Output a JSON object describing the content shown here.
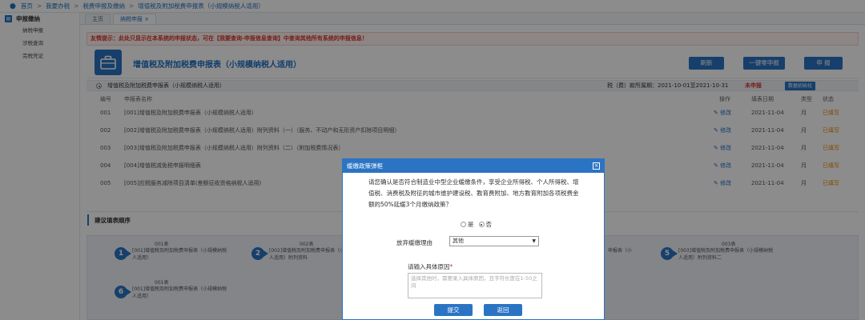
{
  "breadcrumb": [
    "首页",
    "我要办税",
    "税费申报及缴纳",
    "增值税及附加税费申报表（小规模纳税人适用）"
  ],
  "sidebar": {
    "section": "申报缴纳",
    "items": [
      "纳税申报",
      "涉税查询",
      "完税凭证"
    ]
  },
  "tabs": [
    {
      "label": "主页"
    },
    {
      "label": "纳税申报 ×"
    }
  ],
  "warning": "友情提示：此处只显示在本系统的申报状态，可在【我要查询-申报信息查询】中查询其他所有系统的申报信息！",
  "header": {
    "title": "增值税及附加税费申报表（小规模纳税人适用）",
    "refresh_label": "刷新",
    "zero_label": "一键零申报",
    "submit_label": "申  报"
  },
  "infobar": {
    "name": "增值税及附加税费申报表（小规模纳税人适用）",
    "period": "税（费）款所属期：2021-10-01至2021-10-31",
    "status": "未申报",
    "format_label": "数据初始化"
  },
  "table": {
    "headers": [
      "编号",
      "申报表名称",
      "操作",
      "填表日期",
      "类型",
      "状态"
    ],
    "rows": [
      {
        "no": "001",
        "name": "[001]增值税及附加税费申报表（小规模纳税人适用）",
        "op": "修改",
        "date": "2021-11-04",
        "type": "月",
        "status": "已填写"
      },
      {
        "no": "002",
        "name": "[002]增值税及附加税费申报表（小规模纳税人适用）附列资料（一）（服务、不动产和无形资产扣除项目明细）",
        "op": "修改",
        "date": "2021-11-04",
        "type": "月",
        "status": "已填写"
      },
      {
        "no": "003",
        "name": "[003]增值税及附加税费申报表（小规模纳税人适用）附列资料（二）（附加税费情况表）",
        "op": "修改",
        "date": "2021-11-04",
        "type": "月",
        "status": "已填写"
      },
      {
        "no": "004",
        "name": "[004]增值税减免税申报明细表",
        "op": "修改",
        "date": "2021-11-04",
        "type": "月",
        "status": "已填写"
      },
      {
        "no": "005",
        "name": "[005]应税服务减除项目清单(差额征收资格纳税人适用)",
        "op": "修改",
        "date": "2021-11-04",
        "type": "月",
        "status": "已填写"
      }
    ]
  },
  "suggest_title": "建议填表顺序",
  "steps": [
    {
      "num": "1",
      "label": "001表",
      "desc": "[001]增值税及附加税费申报表（小规模纳税人适用）"
    },
    {
      "num": "2",
      "label": "002表",
      "desc": "[002]增值税及附加税费申报表（小规模纳税人适用）附列资料"
    },
    {
      "num": "5",
      "label": "003表",
      "desc": "[003]增值税及附加税费申报表（小规模纳税人适用）附列资料二"
    },
    {
      "num": "6",
      "label": "001表",
      "desc": "[001]增值税及附加税费申报表（小规模纳税人适用）"
    }
  ],
  "step_partial": "申报表（小",
  "modal": {
    "title": "缓缴政策弹框",
    "close": "×",
    "text": "请您确认是否符合制造业中型企业缓缴条件，享受企业所得税、个人所得税、增值税、消费税及附征的城市维护建设税、教育费附加、地方教育附加各项税费金额的50%延缓3个月缴纳政策？",
    "yes": "是",
    "no": "否",
    "select_label": "放弃缓缴理由",
    "select_value": "其他",
    "reason_label": "请输入具体原因",
    "reason_required": "*",
    "reason_placeholder": "选择其他时，需要录入具体原因，且字符长度在1-50之间",
    "submit": "提交",
    "back": "返回"
  }
}
